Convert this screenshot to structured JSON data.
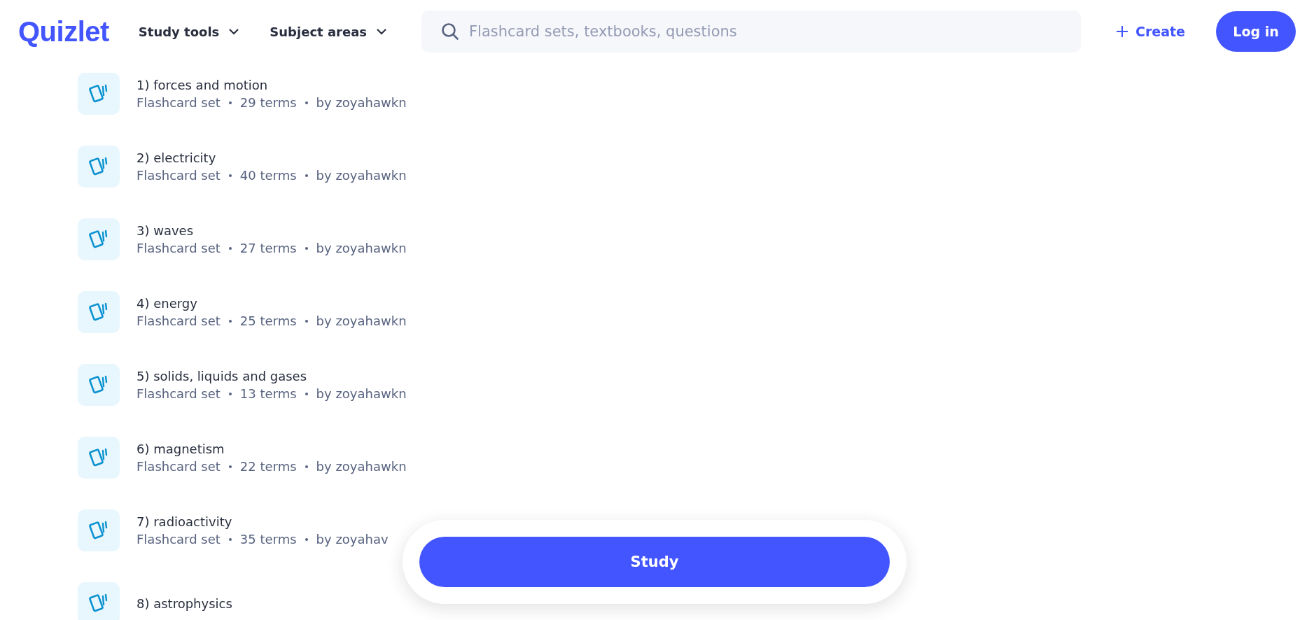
{
  "header": {
    "logo": "Quizlet",
    "nav": [
      {
        "label": "Study tools"
      },
      {
        "label": "Subject areas"
      }
    ],
    "search": {
      "placeholder": "Flashcard sets, textbooks, questions"
    },
    "create": "Create",
    "login": "Log in"
  },
  "sets": [
    {
      "title": "1) forces and motion",
      "type": "Flashcard set",
      "terms": "29 terms",
      "author": "by zoyahawkn"
    },
    {
      "title": "2) electricity",
      "type": "Flashcard set",
      "terms": "40 terms",
      "author": "by zoyahawkn"
    },
    {
      "title": "3) waves",
      "type": "Flashcard set",
      "terms": "27 terms",
      "author": "by zoyahawkn"
    },
    {
      "title": "4) energy",
      "type": "Flashcard set",
      "terms": "25 terms",
      "author": "by zoyahawkn"
    },
    {
      "title": "5) solids, liquids and gases",
      "type": "Flashcard set",
      "terms": "13 terms",
      "author": "by zoyahawkn"
    },
    {
      "title": "6) magnetism",
      "type": "Flashcard set",
      "terms": "22 terms",
      "author": "by zoyahawkn"
    },
    {
      "title": "7) radioactivity",
      "type": "Flashcard set",
      "terms": "35 terms",
      "author": "by zoyahav"
    },
    {
      "title": "8) astrophysics"
    }
  ],
  "study_button": "Study"
}
